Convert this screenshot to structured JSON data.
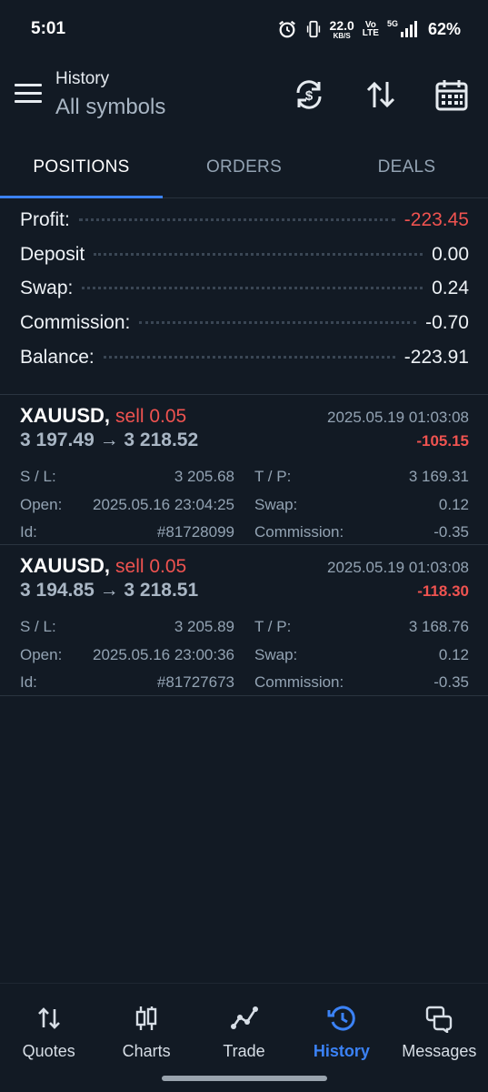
{
  "status_bar": {
    "time": "5:01",
    "speed_value": "22.0",
    "speed_unit": "KB/S",
    "volte_top": "Vo",
    "volte_bottom": "LTE",
    "network": "5G",
    "battery": "62%"
  },
  "header": {
    "title": "History",
    "subtitle": "All symbols",
    "icons": [
      "menu-icon",
      "currency-exchange-icon",
      "sort-icon",
      "calendar-icon"
    ]
  },
  "tabs": [
    {
      "label": "POSITIONS",
      "active": true
    },
    {
      "label": "ORDERS",
      "active": false
    },
    {
      "label": "DEALS",
      "active": false
    }
  ],
  "summary": {
    "profit": {
      "label": "Profit:",
      "value": "-223.45"
    },
    "deposit": {
      "label": "Deposit",
      "value": "0.00"
    },
    "swap": {
      "label": "Swap:",
      "value": "0.24"
    },
    "commission": {
      "label": "Commission:",
      "value": "-0.70"
    },
    "balance": {
      "label": "Balance:",
      "value": "-223.91"
    }
  },
  "positions": [
    {
      "symbol": "XAUUSD,",
      "side": "sell 0.05",
      "close_time": "2025.05.19 01:03:08",
      "prices": "3 197.49 → 3 218.52",
      "profit": "-105.15",
      "sl_label": "S / L:",
      "sl": "3 205.68",
      "tp_label": "T / P:",
      "tp": "3 169.31",
      "open_label": "Open:",
      "open": "2025.05.16 23:04:25",
      "swap_label": "Swap:",
      "swap": "0.12",
      "id_label": "Id:",
      "id": "#81728099",
      "commission_label": "Commission:",
      "commission": "-0.35"
    },
    {
      "symbol": "XAUUSD,",
      "side": "sell 0.05",
      "close_time": "2025.05.19 01:03:08",
      "prices": "3 194.85 → 3 218.51",
      "profit": "-118.30",
      "sl_label": "S / L:",
      "sl": "3 205.89",
      "tp_label": "T / P:",
      "tp": "3 168.76",
      "open_label": "Open:",
      "open": "2025.05.16 23:00:36",
      "swap_label": "Swap:",
      "swap": "0.12",
      "id_label": "Id:",
      "id": "#81727673",
      "commission_label": "Commission:",
      "commission": "-0.35"
    }
  ],
  "bottom_nav": [
    {
      "label": "Quotes",
      "icon": "quotes-arrows-icon",
      "active": false
    },
    {
      "label": "Charts",
      "icon": "candlestick-icon",
      "active": false
    },
    {
      "label": "Trade",
      "icon": "trade-line-icon",
      "active": false
    },
    {
      "label": "History",
      "icon": "history-clock-icon",
      "active": true
    },
    {
      "label": "Messages",
      "icon": "messages-icon",
      "active": false
    }
  ],
  "colors": {
    "background": "#121a24",
    "accent": "#3b82f6",
    "negative": "#ef5350",
    "muted": "#93a3b3"
  }
}
